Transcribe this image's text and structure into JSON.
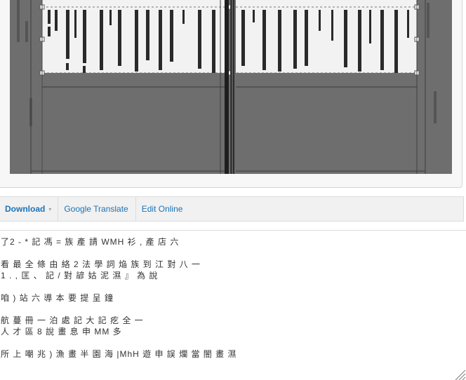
{
  "toolbar": {
    "download_label": "Download",
    "download_caret": "▾",
    "translate_label": "Google Translate",
    "edit_label": "Edit Online"
  },
  "ocr": {
    "lines": [
      "了2 - * 記 馮 = 族 產 請 WMH 衫 , 產 店 六",
      "",
      "看 最 全 條 由 絡 2 法 學 詞 焔 族 到 江 對 八 一",
      "1 . , 匡 、 記 / 對 諺 姑 泥 濕 』 為 說",
      "",
      "咱 ) 站 六 導 本 要 提 呈 鐘",
      "",
      "航 蔓 冊 一 泊 處 記 大 記 疙 全 一",
      "人 才 區 8 說 畫 息 申 MM 多",
      "",
      "所 上 嘲 兆 ) 漁 畫 半 園 海 |MhH 遊 申 誤 爛 當 闇 畫 濕"
    ]
  },
  "icons": {
    "download_caret": "chevron-down-icon",
    "resize": "resize-grip-icon"
  },
  "colors": {
    "link": "#1a73b8",
    "toolbar_bg": "#f1f1f1",
    "scan_bg": "#6e6e6e",
    "highlight": "#ffffff"
  }
}
